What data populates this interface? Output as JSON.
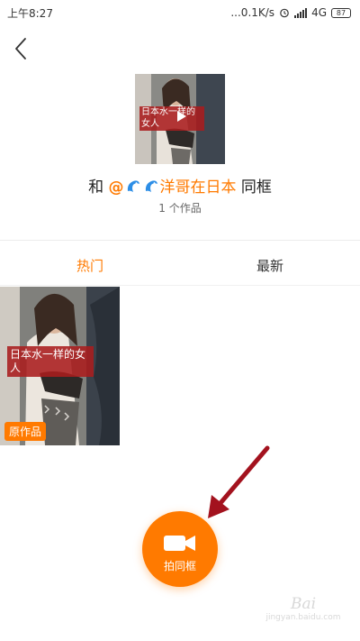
{
  "status_bar": {
    "time": "上午8:27",
    "network_speed": "...0.1K/s",
    "network_type": "4G",
    "battery": "87"
  },
  "header": {
    "cover_caption": "日本水一样的女人",
    "title_prefix": "和",
    "title_at": "@",
    "title_user": "洋哥在日本",
    "title_suffix": "同框",
    "works_count": "1 个作品"
  },
  "tabs": [
    {
      "label": "热门",
      "active": true
    },
    {
      "label": "最新",
      "active": false
    }
  ],
  "videos": [
    {
      "caption": "日本水一样的女人",
      "badge": "原作品"
    }
  ],
  "action": {
    "label": "拍同框",
    "icon": "video-camera-icon"
  },
  "watermark": {
    "text": "Bai",
    "sub": "jingyan.baidu.com"
  },
  "colors": {
    "accent": "#ff7a00",
    "caption_bg": "#aa1c1e",
    "annotation_arrow": "#a3121e"
  }
}
